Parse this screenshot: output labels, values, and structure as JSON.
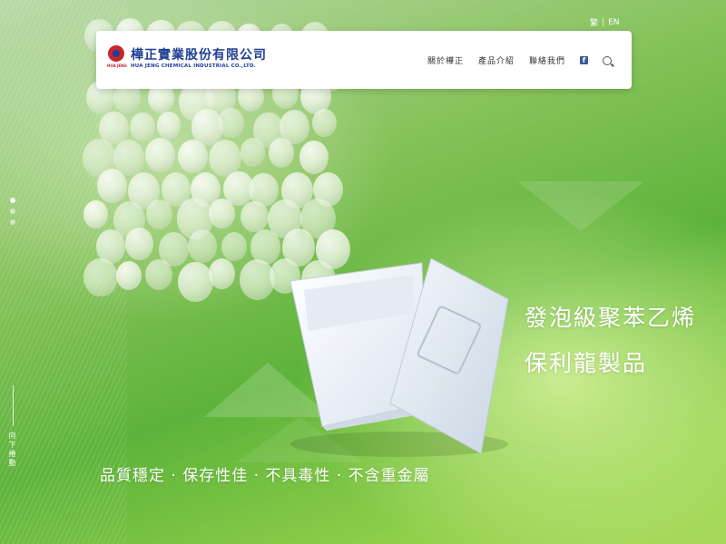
{
  "header": {
    "brand_name": "樺正實業股份有限公司",
    "brand_en": "HUA JENG CHEMICAL INDUSTRIAL CO.,LTD.",
    "logo_sub": "HUA JENG",
    "nav": [
      {
        "label": "關於樺正"
      },
      {
        "label": "產品介紹"
      },
      {
        "label": "聯絡我們"
      }
    ],
    "facebook_icon": "facebook-icon",
    "search_icon": "search-icon"
  },
  "language": {
    "current": "繁",
    "separator": "|",
    "other": "EN"
  },
  "slider": {
    "total": 3,
    "active_index": 0
  },
  "scroll_hint": "向下捲動",
  "hero": {
    "headline_line1": "發泡級聚苯乙烯",
    "headline_line2": "保利龍製品",
    "tagline": "品質穩定 · 保存性佳 · 不具毒性 · 不含重金屬"
  },
  "colors": {
    "brand_blue": "#1f3f94",
    "brand_red": "#c8242b",
    "accent_green": "#5db33a"
  }
}
